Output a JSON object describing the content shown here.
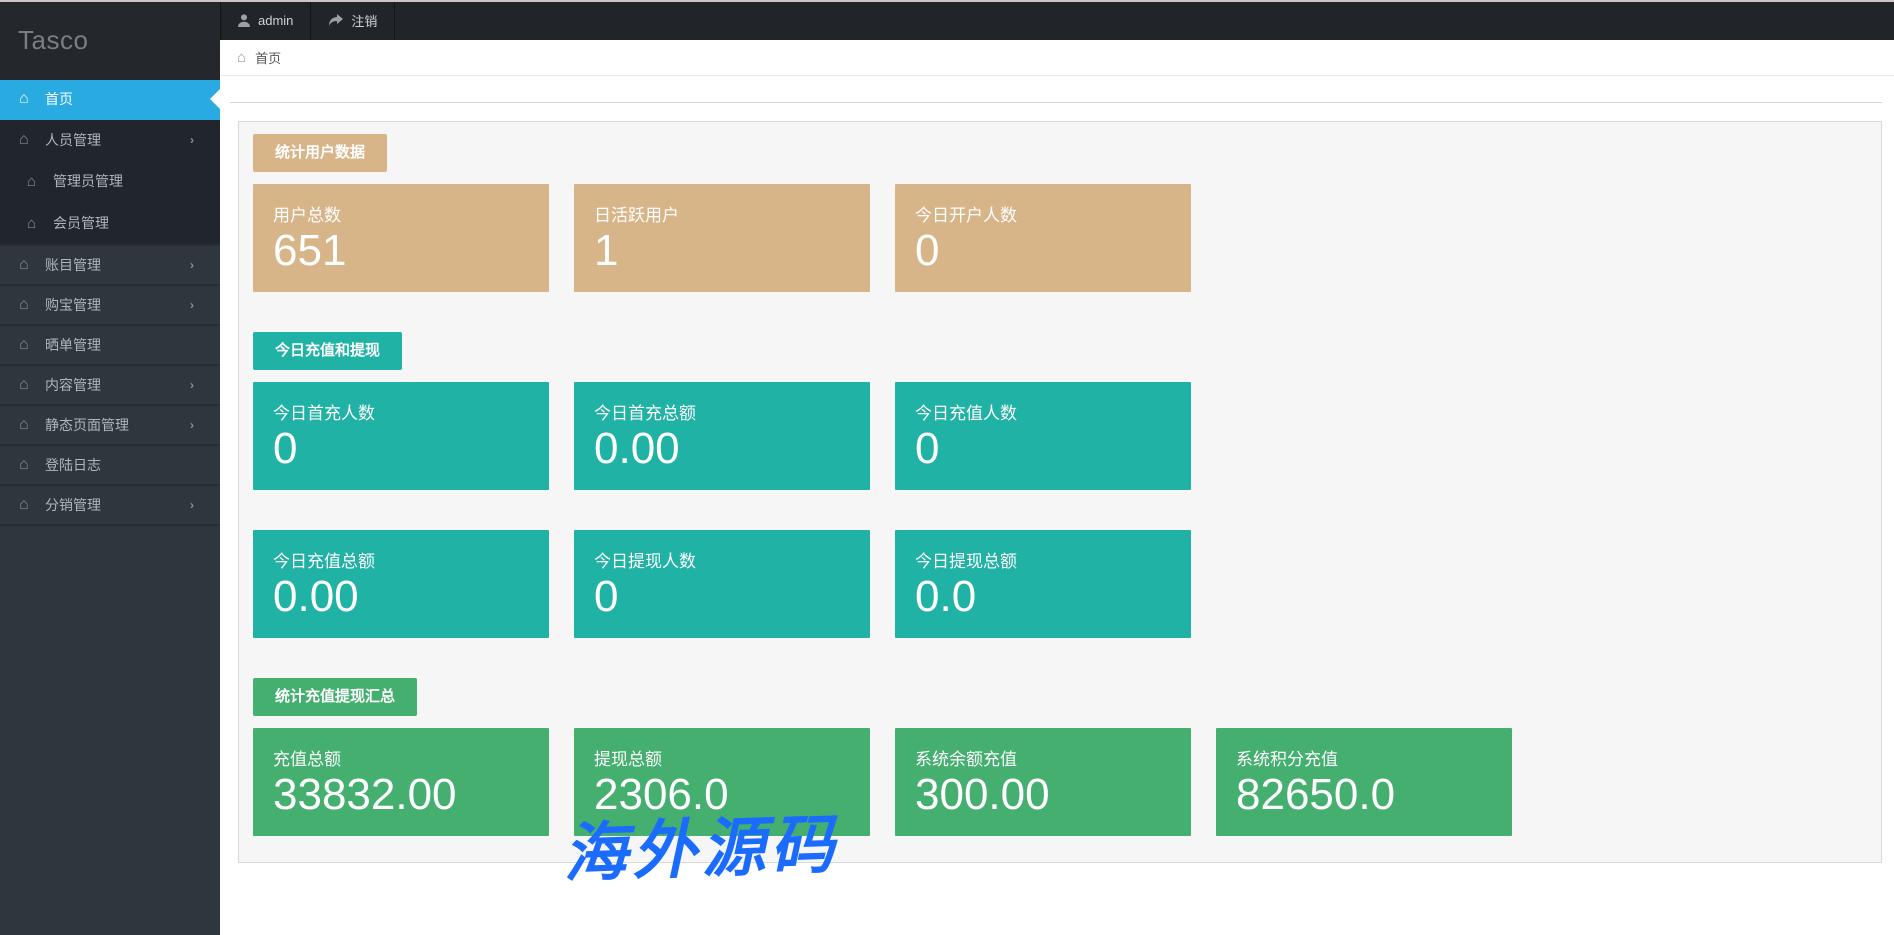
{
  "brand": "Tasco",
  "topbar": {
    "user_label": "admin",
    "logout_label": "注销"
  },
  "breadcrumb": {
    "home_label": "首页"
  },
  "sidebar": {
    "items": [
      {
        "label": "首页",
        "active": true
      },
      {
        "label": "人员管理",
        "expandable": true,
        "expanded": true,
        "children": [
          {
            "label": "管理员管理"
          },
          {
            "label": "会员管理"
          }
        ]
      },
      {
        "label": "账目管理",
        "expandable": true
      },
      {
        "label": "购宝管理",
        "expandable": true
      },
      {
        "label": "晒单管理"
      },
      {
        "label": "内容管理",
        "expandable": true
      },
      {
        "label": "静态页面管理",
        "expandable": true
      },
      {
        "label": "登陆日志"
      },
      {
        "label": "分销管理",
        "expandable": true
      }
    ]
  },
  "dashboard": {
    "sections": [
      {
        "title": "统计用户数据",
        "color": "#d8b589",
        "rows": [
          [
            {
              "label": "用户总数",
              "value": "651"
            },
            {
              "label": "日活跃用户",
              "value": "1"
            },
            {
              "label": "今日开户人数",
              "value": "0"
            }
          ]
        ]
      },
      {
        "title": "今日充值和提现",
        "color": "#21b2a6",
        "rows": [
          [
            {
              "label": "今日首充人数",
              "value": "0"
            },
            {
              "label": "今日首充总额",
              "value": "0.00"
            },
            {
              "label": "今日充值人数",
              "value": "0"
            }
          ],
          [
            {
              "label": "今日充值总额",
              "value": "0.00"
            },
            {
              "label": "今日提现人数",
              "value": "0"
            },
            {
              "label": "今日提现总额",
              "value": "0.0"
            }
          ]
        ]
      },
      {
        "title": "统计充值提现汇总",
        "color": "#45af70",
        "rows": [
          [
            {
              "label": "充值总额",
              "value": "33832.00"
            },
            {
              "label": "提现总额",
              "value": "2306.0"
            },
            {
              "label": "系统余额充值",
              "value": "300.00"
            },
            {
              "label": "系统积分充值",
              "value": "82650.0"
            }
          ]
        ]
      }
    ]
  },
  "watermark": {
    "text": "海外源码",
    "color": "#1b6cfe"
  },
  "colors": {
    "accent_blue": "#29abe2",
    "sidebar_bg": "#2f363e",
    "topbar_bg": "#212529",
    "tan": "#d8b589",
    "teal": "#21b2a6",
    "green": "#45af70"
  },
  "icons": {
    "home": "⌂",
    "chevron": "›"
  }
}
